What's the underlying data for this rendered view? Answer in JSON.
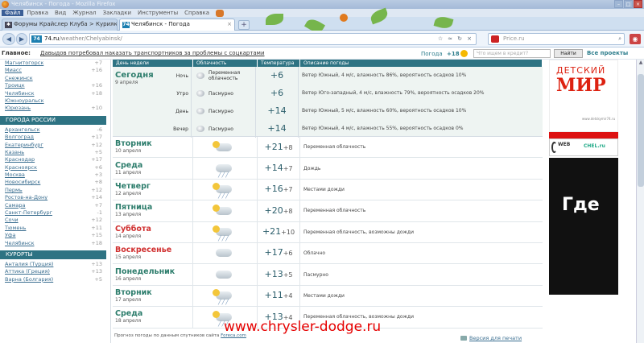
{
  "window": {
    "title": "Челябинск - Погода - Mozilla Firefox"
  },
  "menu": [
    "Файл",
    "Правка",
    "Вид",
    "Журнал",
    "Закладки",
    "Инструменты",
    "Справка"
  ],
  "tabs": [
    {
      "label": "Форумы Крайслер Клуба > Курилка",
      "favicon": "forum-icon"
    },
    {
      "label": "Челябинск - Погода",
      "favicon": "74",
      "active": true
    }
  ],
  "nav": {
    "url_host": "74.ru",
    "url_path": "/weather/Chelyabinsk/",
    "url_favicon": "74",
    "search_placeholder": "Price.ru"
  },
  "newsbar": {
    "label": "Главное:",
    "headline": "Давыдов потребовал наказать транспортников за проблемы с соцкартами",
    "weather_label": "Погода",
    "weather_temp": "+18",
    "site_search_placeholder": "Что ищем в кредит?",
    "find_button": "Найти",
    "all_projects": "Все проекты"
  },
  "sidebar": {
    "top_cities": [
      {
        "name": "Магнитогорск",
        "temp": "+7"
      },
      {
        "name": "Миасс",
        "temp": "+16"
      },
      {
        "name": "Снежинск",
        "temp": ""
      },
      {
        "name": "Троицк",
        "temp": "+16"
      },
      {
        "name": "Челябинск",
        "temp": "+18"
      },
      {
        "name": "Южноуральск",
        "temp": ""
      },
      {
        "name": "Юрюзань",
        "temp": "+10"
      }
    ],
    "russia_title": "ГОРОДА РОССИИ",
    "russia": [
      {
        "name": "Архангельск",
        "temp": "-6"
      },
      {
        "name": "Волгоград",
        "temp": "+17"
      },
      {
        "name": "Екатеринбург",
        "temp": "+12"
      },
      {
        "name": "Казань",
        "temp": "+5"
      },
      {
        "name": "Краснодар",
        "temp": "+17"
      },
      {
        "name": "Красноярск",
        "temp": "+6"
      },
      {
        "name": "Москва",
        "temp": "+3"
      },
      {
        "name": "Новосибирск",
        "temp": "+8"
      },
      {
        "name": "Пермь",
        "temp": "+12"
      },
      {
        "name": "Ростов-на-Дону",
        "temp": "+14"
      },
      {
        "name": "Самара",
        "temp": "+7"
      },
      {
        "name": "Санкт-Петербург",
        "temp": "-1"
      },
      {
        "name": "Сочи",
        "temp": "+12"
      },
      {
        "name": "Тюмень",
        "temp": "+11"
      },
      {
        "name": "Уфа",
        "temp": "+15"
      },
      {
        "name": "Челябинск",
        "temp": "+18"
      }
    ],
    "resorts_title": "КУРОРТЫ",
    "resorts": [
      {
        "name": "Анталия (Турция)",
        "temp": "+13"
      },
      {
        "name": "Аттика (Греция)",
        "temp": "+13"
      },
      {
        "name": "Варна (Болгария)",
        "temp": "+5"
      }
    ]
  },
  "table": {
    "headers": [
      "День недели",
      "Облачность",
      "Температура",
      "Описание погоды"
    ],
    "today": {
      "day": "Сегодня",
      "date": "9 апреля",
      "parts": [
        {
          "label": "Ночь",
          "cloud": "Переменная облачность",
          "temp": "+6",
          "desc": "Ветер Южный, 4 м/с, влажность 86%, вероятность осадков 10%"
        },
        {
          "label": "Утро",
          "cloud": "Пасмурно",
          "temp": "+6",
          "desc": "Ветер Юго-западный, 4 м/с, влажность 79%, вероятность осадков 20%"
        },
        {
          "label": "День",
          "cloud": "Пасмурно",
          "temp": "+14",
          "desc": "Ветер Южный, 5 м/с, влажность 60%, вероятность осадков 10%"
        },
        {
          "label": "Вечер",
          "cloud": "Пасмурно",
          "temp": "+14",
          "desc": "Ветер Южный, 4 м/с, влажность 55%, вероятность осадков 0%"
        }
      ]
    },
    "days": [
      {
        "day": "Вторник",
        "date": "10 апреля",
        "hi": "+21",
        "lo": "+8",
        "desc": "Переменная облачность",
        "icon": "partly-cloudy-icon",
        "weekend": false
      },
      {
        "day": "Среда",
        "date": "11 апреля",
        "hi": "+14",
        "lo": "+7",
        "desc": "Дождь",
        "icon": "rain-icon",
        "weekend": false
      },
      {
        "day": "Четверг",
        "date": "12 апреля",
        "hi": "+16",
        "lo": "+7",
        "desc": "Местами дожди",
        "icon": "showers-icon",
        "weekend": false
      },
      {
        "day": "Пятница",
        "date": "13 апреля",
        "hi": "+20",
        "lo": "+8",
        "desc": "Переменная облачность",
        "icon": "partly-cloudy-icon",
        "weekend": false
      },
      {
        "day": "Суббота",
        "date": "14 апреля",
        "hi": "+21",
        "lo": "+10",
        "desc": "Переменная облачность, возможны дожди",
        "icon": "showers-icon",
        "weekend": true
      },
      {
        "day": "Воскресенье",
        "date": "15 апреля",
        "hi": "+17",
        "lo": "+6",
        "desc": "Облачно",
        "icon": "cloudy-icon",
        "weekend": true
      },
      {
        "day": "Понедельник",
        "date": "16 апреля",
        "hi": "+13",
        "lo": "+5",
        "desc": "Пасмурно",
        "icon": "overcast-icon",
        "weekend": false
      },
      {
        "day": "Вторник",
        "date": "17 апреля",
        "hi": "+11",
        "lo": "+4",
        "desc": "Местами дожди",
        "icon": "showers-icon",
        "weekend": false
      },
      {
        "day": "Среда",
        "date": "18 апреля",
        "hi": "+13",
        "lo": "+4",
        "desc": "Переменная облачность, возможны дожди",
        "icon": "showers-icon",
        "weekend": false
      }
    ],
    "footnote_prefix": "Прогноз погоды по данным спутников сайта",
    "footnote_link": "Foreca.com",
    "print_link": "Версия для печати"
  },
  "ads": {
    "ad1_line1": "ДЕТСКИЙ",
    "ad1_line2": "МИР",
    "ad1_url": "www.detskymir74.ru",
    "ad2_web": "WEB",
    "ad2_chel": "CHEL.ru",
    "ad3_text": "Где"
  },
  "watermark": "www.chrysler-dodge.ru"
}
